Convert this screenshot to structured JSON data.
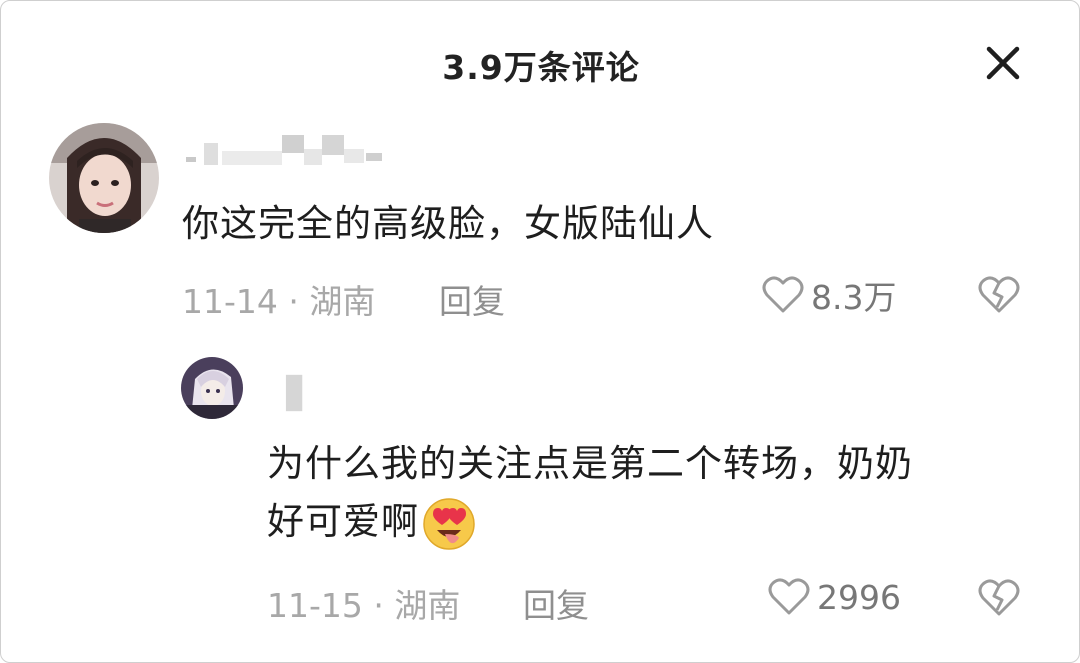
{
  "header": {
    "title": "3.9万条评论",
    "close_icon": "close-icon"
  },
  "comments": [
    {
      "username": "",
      "text": "你这完全的高级脸，女版陆仙人",
      "date": "11-14",
      "location": "湖南",
      "reply_label": "回复",
      "likes": "8.3万",
      "replies": [
        {
          "username": "",
          "text_line1": "为什么我的关注点是第二个转场，奶奶",
          "text_line2": "好可爱啊",
          "emoji": "heart-eyes-tongue-emoji",
          "date": "11-15",
          "location": "湖南",
          "reply_label": "回复",
          "likes": "2996"
        }
      ]
    }
  ],
  "separator": "·",
  "colors": {
    "text": "#1e1e1e",
    "meta": "#a8a8a8",
    "icon": "#9a9a9a"
  }
}
